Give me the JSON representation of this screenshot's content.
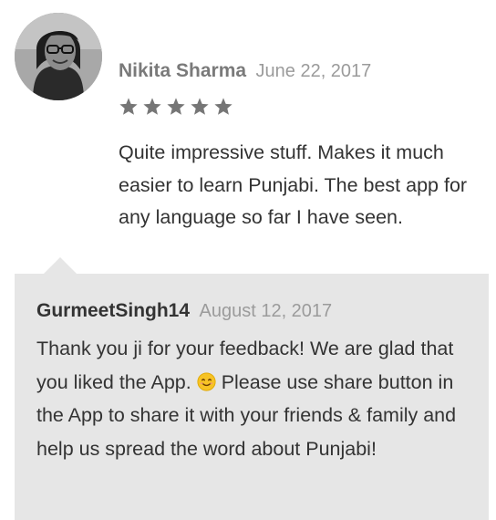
{
  "review": {
    "author": "Nikita Sharma",
    "date": "June 22, 2017",
    "rating": 5,
    "text": "Quite impressive stuff. Makes it much easier to learn Punjabi. The best app for any language so far I have seen."
  },
  "reply": {
    "author": "GurmeetSingh14",
    "date": "August 12, 2017",
    "text_before_emoji": "Thank you ji for your feedback! We are glad that you liked the App. ",
    "emoji": "smiling-face-icon",
    "text_after_emoji": " Please use share button in the App to share it with your friends & family and help us spread the word about Punjabi!"
  },
  "colors": {
    "star": "#767676",
    "reply_background": "#e6e6e6",
    "emoji_fill": "#f7c325"
  }
}
